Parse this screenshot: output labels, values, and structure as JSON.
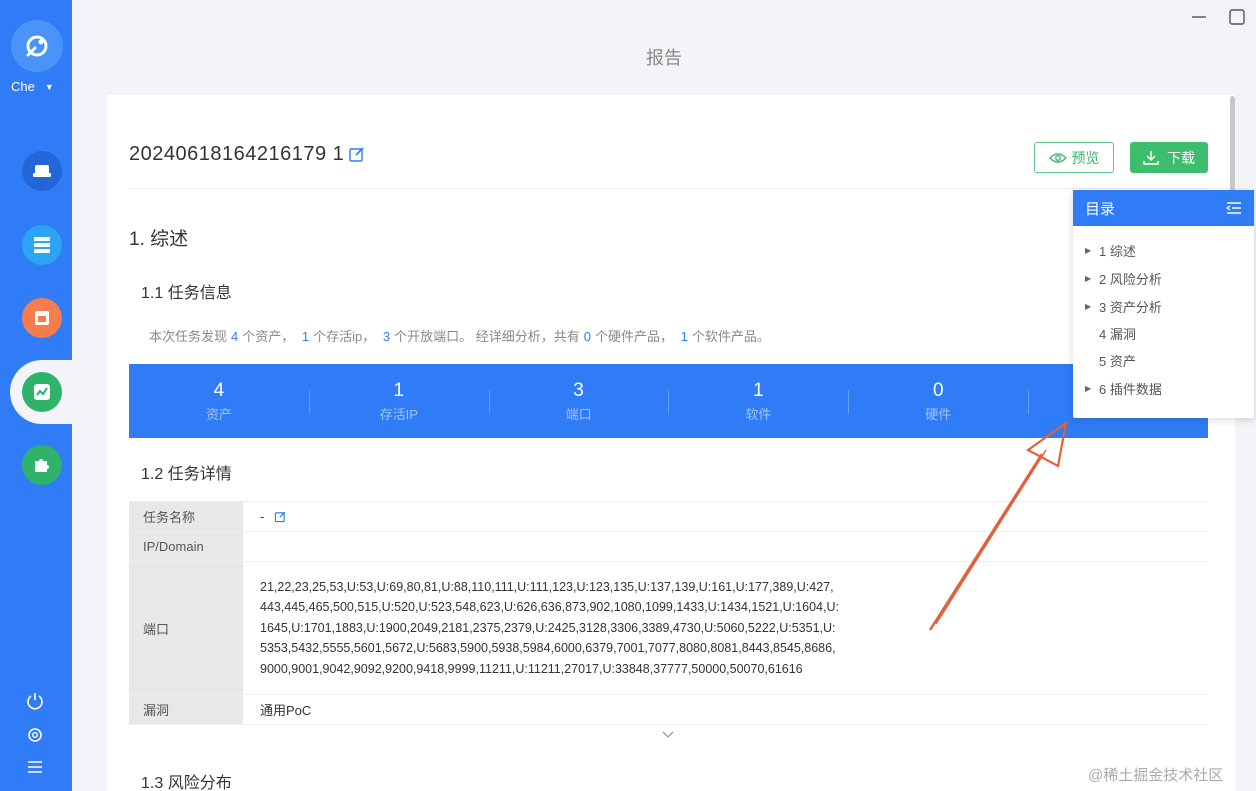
{
  "app": {
    "user_name": "Che",
    "page_title": "报告"
  },
  "report": {
    "id": "20240618164216179 1",
    "preview_label": "预览",
    "download_label": "下载"
  },
  "sections": {
    "overview": "1. 综述",
    "task_info": "1.1 任务信息",
    "task_details": "1.2 任务详情",
    "risk_distribution": "1.3 风险分布"
  },
  "summary": {
    "t1": "本次任务发现",
    "assets": "4",
    "t2": "个资产，",
    "alive_ip": "1",
    "t3": "个存活ip，",
    "open_ports": "3",
    "t4": "个开放端口。 经详细分析，共有",
    "hardware": "0",
    "t5": "个硬件产品，",
    "software": "1",
    "t6": "个软件产品。"
  },
  "stats": [
    {
      "value": "4",
      "label": "资产"
    },
    {
      "value": "1",
      "label": "存活IP"
    },
    {
      "value": "3",
      "label": "端口"
    },
    {
      "value": "1",
      "label": "软件"
    },
    {
      "value": "0",
      "label": "硬件"
    },
    {
      "value": "",
      "label": ""
    }
  ],
  "details": {
    "task_name_label": "任务名称",
    "task_name_value": "-",
    "ip_label": "IP/Domain",
    "ip_value": "",
    "ports_label": "端口",
    "ports_value": "21,22,23,25,53,U:53,U:69,80,81,U:88,110,111,U:111,123,U:123,135,U:137,139,U:161,U:177,389,U:427,443,445,465,500,515,U:520,U:523,548,623,U:626,636,873,902,1080,1099,1433,U:1434,1521,U:1604,U:1645,U:1701,1883,U:1900,2049,2181,2375,2379,U:2425,3128,3306,3389,4730,U:5060,5222,U:5351,U:5353,5432,5555,5601,5672,U:5683,5900,5938,5984,6000,6379,7001,7077,8080,8081,8443,8545,8686,9000,9001,9042,9092,9200,9418,9999,11211,U:11211,27017,U:33848,37777,50000,50070,61616",
    "vuln_label": "漏洞",
    "vuln_value": "通用PoC"
  },
  "toc": {
    "title": "目录",
    "items": [
      {
        "label": "1 综述",
        "expandable": true
      },
      {
        "label": "2 风险分析",
        "expandable": true
      },
      {
        "label": "3 资产分析",
        "expandable": true
      },
      {
        "label": "4 漏洞",
        "expandable": false
      },
      {
        "label": "5 资产",
        "expandable": false
      },
      {
        "label": "6 插件数据",
        "expandable": true
      }
    ]
  },
  "watermark": "@稀土掘金技术社区",
  "colors": {
    "primary": "#2f7cf6",
    "success": "#3ebd6e",
    "annotation": "#e0623a"
  }
}
